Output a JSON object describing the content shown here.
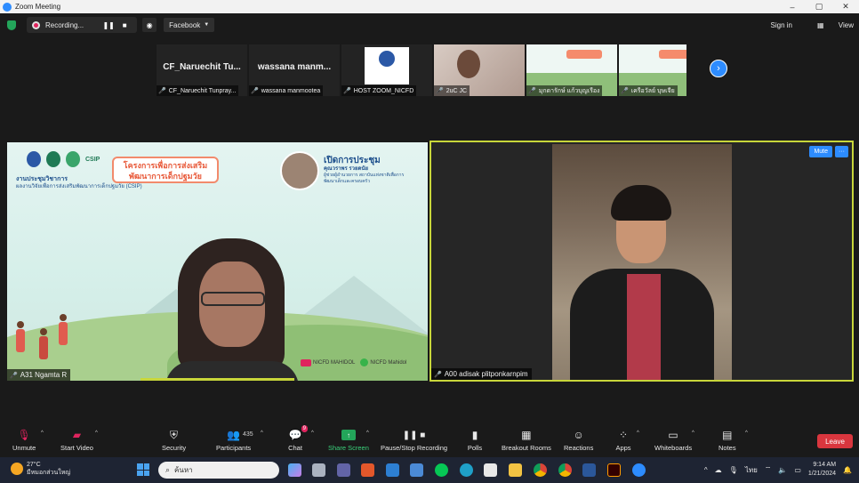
{
  "window": {
    "title": "Zoom Meeting",
    "controls": [
      "–",
      "▢",
      "✕"
    ]
  },
  "topbar": {
    "recording_label": "Recording...",
    "live_target": "Facebook",
    "sign_in": "Sign in",
    "view": "View"
  },
  "thumbnails": [
    {
      "big_name": "CF_Naruechit  Tu...",
      "name": "CF_Naruechit Tunpray..."
    },
    {
      "big_name": "wassana  manm...",
      "name": "wassana manmootea"
    },
    {
      "big_name": "",
      "name": "HOST ZOOM_NICFD"
    },
    {
      "big_name": "",
      "name": "2uC JC"
    },
    {
      "big_name": "",
      "name": "มุกดารักษ์ แก้วบุญเรือง"
    },
    {
      "big_name": "",
      "name": "เครือวัลย์ บุษเจีย"
    }
  ],
  "main_left": {
    "participant": "A31 Ngamta R",
    "slide": {
      "title": "โครงการเพื่อการส่งเสริมพัฒนาการเด็กปฐมวัย",
      "csip": "CSIP",
      "sub_heading": "งานประชุมวิชาการ",
      "sub_text": "ผลงานวิจัยเพื่อการส่งเสริมพัฒนาการเด็กปฐมวัย (CSIP)",
      "open_title": "เปิดการประชุม",
      "open_name": "คุณวราพร รวยดนัย",
      "open_role": "ผู้ช่วยผู้อำนวยการ สถาบันแห่งชาติเพื่อการพัฒนาเด็กและครอบครัว",
      "yt_label": "NICFD MAHIDOL",
      "line_label": "NICFD Mahidol"
    }
  },
  "main_right": {
    "participant": "A00 adisak plitponkarnpim",
    "mute": "Mute",
    "more": "···"
  },
  "toolbar": {
    "unmute": "Unmute",
    "start_video": "Start Video",
    "security": "Security",
    "participants": "Participants",
    "participants_count": "435",
    "chat": "Chat",
    "chat_badge": "9",
    "share_screen": "Share Screen",
    "pause_recording": "Pause/Stop Recording",
    "polls": "Polls",
    "breakout": "Breakout Rooms",
    "reactions": "Reactions",
    "apps": "Apps",
    "whiteboards": "Whiteboards",
    "notes": "Notes",
    "leave": "Leave"
  },
  "taskbar": {
    "temp": "27°C",
    "weather": "มีหมอกส่วนใหญ่",
    "search_placeholder": "ค้นหา",
    "lang": "ไทย",
    "time": "9:14 AM",
    "date": "1/21/2024"
  },
  "colors": {
    "accent": "#2d8cff",
    "active_speaker": "#c8d63a",
    "leave": "#d9363e",
    "share": "#23a55a"
  }
}
